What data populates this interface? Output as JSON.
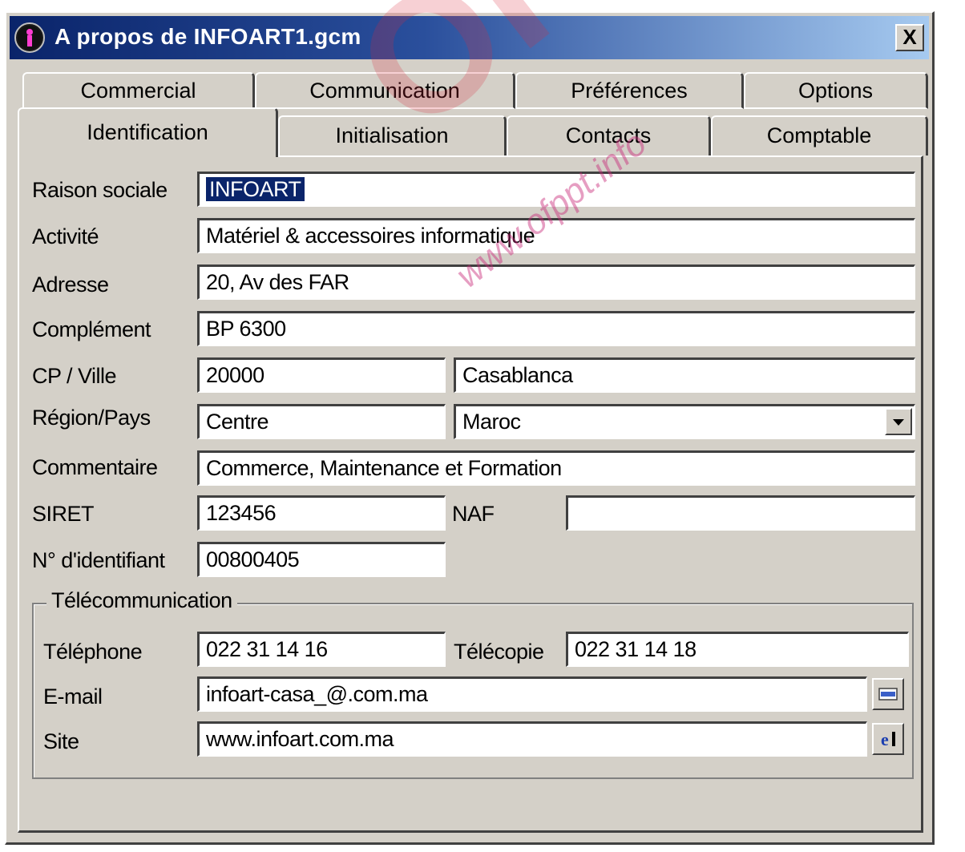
{
  "window": {
    "title": "A propos de INFOART1.gcm",
    "close_label": "X"
  },
  "tabs": {
    "back_row": [
      "Commercial",
      "Communication",
      "Préférences",
      "Options"
    ],
    "front_row": [
      "Identification",
      "Initialisation",
      "Contacts",
      "Comptable"
    ],
    "active": "Identification"
  },
  "form": {
    "raison_sociale": {
      "label": "Raison sociale",
      "value": "INFOART"
    },
    "activite": {
      "label": "Activité",
      "value": "Matériel & accessoires informatique"
    },
    "adresse": {
      "label": "Adresse",
      "value": "20, Av des FAR"
    },
    "complement": {
      "label": "Complément",
      "value": "BP 6300"
    },
    "cp_ville": {
      "label": "CP / Ville",
      "cp": "20000",
      "ville": "Casablanca"
    },
    "region_pays": {
      "label": "Région/Pays",
      "region": "Centre",
      "pays": "Maroc"
    },
    "commentaire": {
      "label": "Commentaire",
      "value": "Commerce, Maintenance et Formation"
    },
    "siret": {
      "label": "SIRET",
      "value": "123456"
    },
    "naf": {
      "label": "NAF",
      "value": ""
    },
    "identifiant": {
      "label": "N° d'identifiant",
      "value": "00800405"
    }
  },
  "telecom": {
    "legend": "Télécommunication",
    "telephone": {
      "label": "Téléphone",
      "value": "022 31 14 16"
    },
    "telecopie": {
      "label": "Télécopie",
      "value": "022 31 14 18"
    },
    "email": {
      "label": "E-mail",
      "value": "infoart-casa_@.com.ma"
    },
    "site": {
      "label": "Site",
      "value": "www.infoart.com.ma"
    }
  },
  "watermark": {
    "brand": "OFPPT",
    "url": "www.ofppt.info"
  },
  "colors": {
    "title_bar": "#0a246a",
    "face": "#d4d0c8",
    "selection": "#0a246a",
    "watermark": "#dc283c"
  }
}
